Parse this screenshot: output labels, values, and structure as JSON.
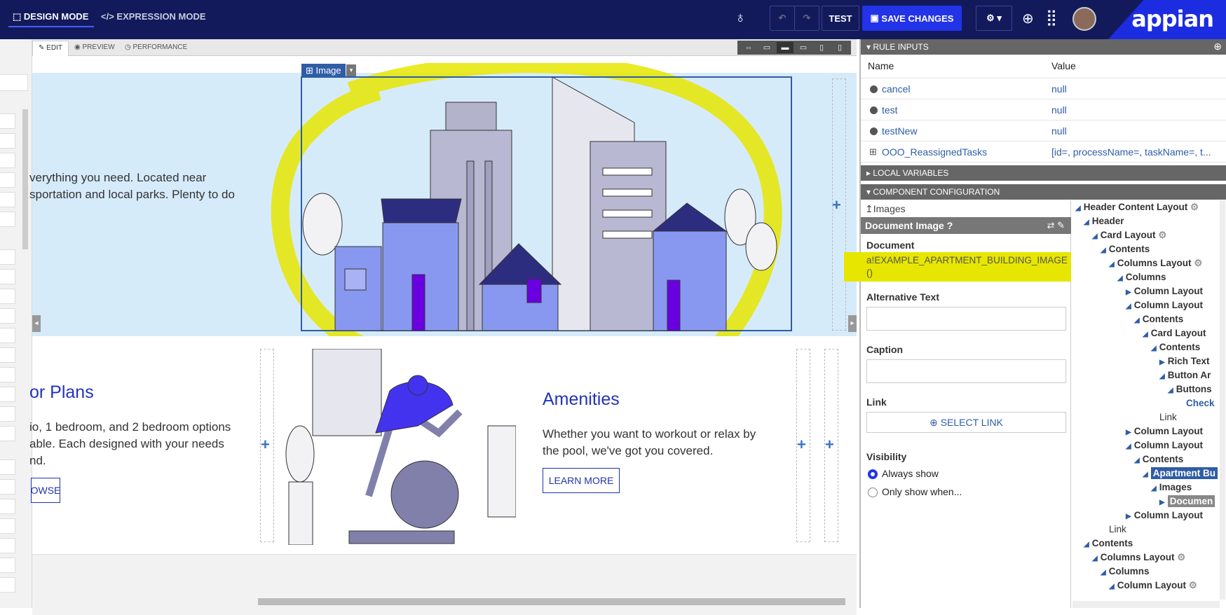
{
  "topbar": {
    "design_mode": "DESIGN MODE",
    "expression_mode": "EXPRESSION MODE",
    "test": "TEST",
    "save_changes": "SAVE CHANGES",
    "logo": "appian"
  },
  "canvas": {
    "tabs": [
      "EDIT",
      "PREVIEW",
      "PERFORMANCE"
    ],
    "image_label": "Image",
    "hero_text_line1": "verything you need. Located near",
    "hero_text_line2": "sportation and local parks. Plenty to do",
    "card1": {
      "heading": "or Plans",
      "body_line1": "io, 1 bedroom, and 2 bedroom options",
      "body_line2": "able. Each designed with your needs",
      "body_line3": "nd.",
      "button": "OWSE"
    },
    "card2": {
      "heading": "Amenities",
      "body_line1": "Whether you want to workout or relax by",
      "body_line2": "the pool, we've got you covered.",
      "button": "LEARN MORE"
    }
  },
  "rule_inputs": {
    "header": "RULE INPUTS",
    "col_name": "Name",
    "col_value": "Value",
    "rows": [
      {
        "name": "cancel",
        "value": "null"
      },
      {
        "name": "test",
        "value": "null"
      },
      {
        "name": "testNew",
        "value": "null"
      },
      {
        "name": "OOO_ReassignedTasks",
        "value": "[id=, processName=, taskName=, t..."
      }
    ]
  },
  "local_variables": "LOCAL VARIABLES",
  "component_config": {
    "header": "COMPONENT CONFIGURATION",
    "breadcrumb": "Images",
    "title": "Document Image",
    "document_label": "Document",
    "document_value_line1": "a!EXAMPLE_APARTMENT_BUILDING_IMAGE",
    "document_value_line2": "()",
    "alt_text_label": "Alternative Text",
    "caption_label": "Caption",
    "link_label": "Link",
    "select_link": "SELECT LINK",
    "visibility_label": "Visibility",
    "always_show": "Always show",
    "only_show": "Only show when..."
  },
  "tree": [
    "Header Content Layout",
    "Header",
    "Card Layout",
    "Contents",
    "Columns Layout",
    "Columns",
    "Column Layout",
    "Column Layout",
    "Contents",
    "Card Layout",
    "Contents",
    "Rich Text",
    "Button Ar",
    "Buttons",
    "Check",
    "Link",
    "Column Layout",
    "Column Layout",
    "Contents",
    "Apartment Bu",
    "Images",
    "Documen",
    "Column Layout",
    "Link",
    "Contents",
    "Columns Layout",
    "Columns",
    "Column Layout"
  ],
  "colors": {
    "topbar": "#121a5c",
    "accent": "#1c2ce0",
    "hero_bg": "#d6ebfa",
    "highlight": "#e6e600"
  }
}
